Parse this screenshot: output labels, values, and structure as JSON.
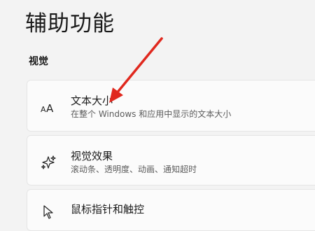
{
  "page": {
    "title": "辅助功能"
  },
  "sections": [
    {
      "title": "视觉",
      "items": [
        {
          "icon": "text-size-icon",
          "label": "文本大小",
          "description": "在整个 Windows 和应用中显示的文本大小"
        },
        {
          "icon": "visual-effects-icon",
          "label": "视觉效果",
          "description": "滚动条、透明度、动画、通知超时"
        },
        {
          "icon": "mouse-pointer-icon",
          "label": "鼠标指针和触控"
        }
      ]
    }
  ],
  "annotation": {
    "color": "#e0281e",
    "type": "red-arrow-pointing-at-text-size"
  }
}
